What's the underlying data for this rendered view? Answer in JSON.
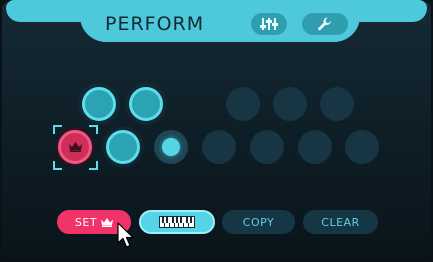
{
  "header": {
    "title": "PERFORM",
    "mixer_button_icon": "mixer-sliders-icon",
    "wrench_button_icon": "wrench-icon"
  },
  "pads": {
    "base_pad_icon": "crown-icon",
    "rows": [
      [
        "on",
        "on",
        "empty",
        "off",
        "off",
        "off"
      ],
      [
        "base",
        "on",
        "current",
        "off",
        "off",
        "off",
        "off"
      ]
    ]
  },
  "buttons": {
    "set_label": "SET",
    "set_icon": "crown-icon",
    "keys_icon": "keyboard-icon",
    "copy_label": "COPY",
    "clear_label": "CLEAR"
  },
  "colors": {
    "accent_cyan": "#4ec9db",
    "active_pad": "#2ca3b3",
    "base_pink": "#f0346a",
    "inactive_pad": "#183543",
    "panel_bg": "#10212a"
  }
}
